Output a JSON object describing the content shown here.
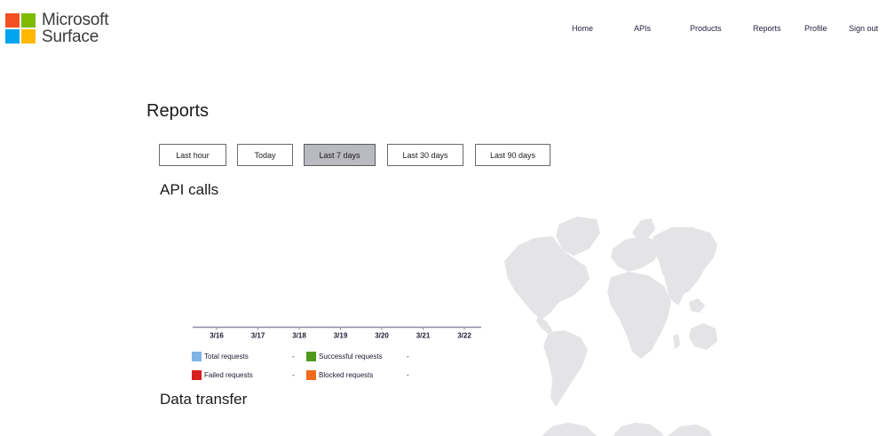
{
  "brand": {
    "name_line1": "Microsoft",
    "name_line2": "Surface",
    "logo_colors": [
      "#f25022",
      "#7fba00",
      "#00a4ef",
      "#ffb900"
    ]
  },
  "nav": {
    "items": [
      {
        "label": "Home",
        "active": false
      },
      {
        "label": "APIs",
        "active": false
      },
      {
        "label": "Products",
        "active": false
      },
      {
        "label": "Reports",
        "active": true
      },
      {
        "label": "Profile",
        "active": false
      },
      {
        "label": "Sign out",
        "active": false
      }
    ]
  },
  "page": {
    "title": "Reports"
  },
  "time_ranges": {
    "options": [
      "Last hour",
      "Today",
      "Last 7 days",
      "Last 30 days",
      "Last 90 days"
    ],
    "selected": "Last 7 days"
  },
  "api_calls": {
    "title": "API calls",
    "dates": [
      "3/16",
      "3/17",
      "3/18",
      "3/19",
      "3/20",
      "3/21",
      "3/22"
    ],
    "legend": [
      {
        "label": "Total requests",
        "value": "-",
        "color": "#7fb5e6"
      },
      {
        "label": "Successful requests",
        "value": "-",
        "color": "#4e9a1c"
      },
      {
        "label": "Failed requests",
        "value": "-",
        "color": "#d81e1e"
      },
      {
        "label": "Blocked requests",
        "value": "-",
        "color": "#ef6a1a"
      }
    ]
  },
  "data_transfer": {
    "title": "Data transfer"
  },
  "map": {
    "color": "#e4e4e7"
  }
}
